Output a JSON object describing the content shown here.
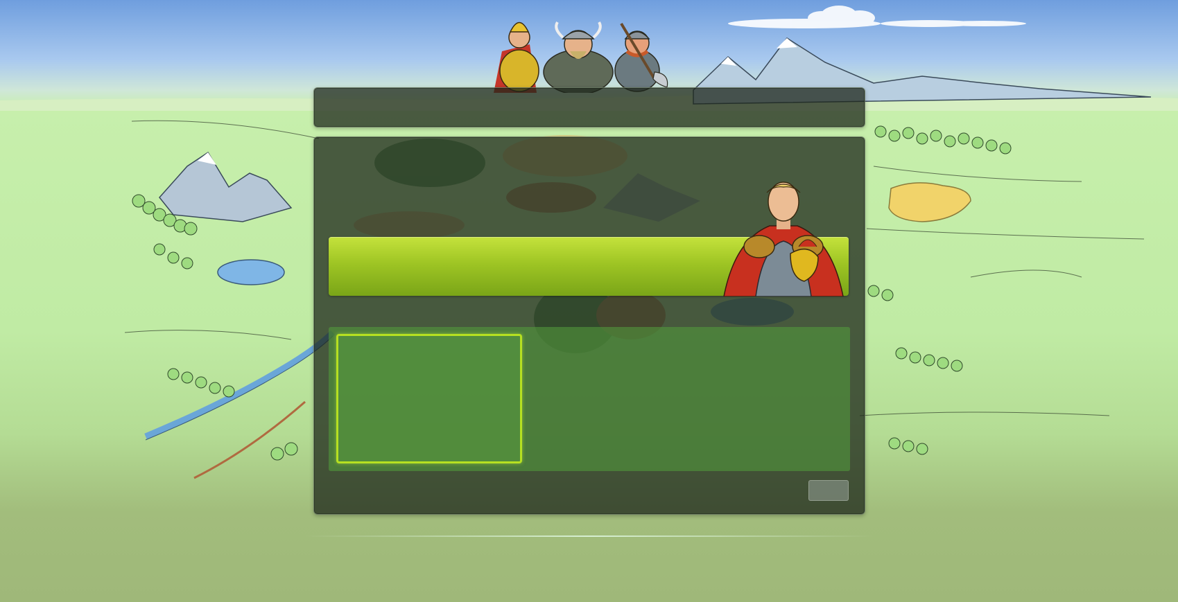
{
  "scene": {
    "name": "game-login-screen",
    "colors": {
      "sky": "#6f9ede",
      "meadow": "#c0eba4",
      "panel": "#1c261a",
      "banner": "#9ec524",
      "card_border": "#b6e021",
      "button": "#78846f"
    }
  },
  "title_panel": {
    "title": ""
  },
  "banner": {
    "label": ""
  },
  "world_card": {
    "label": ""
  },
  "action_button": {
    "label": ""
  },
  "illustrations": {
    "heroes_group": [
      "golden-armor-warrior",
      "horned-helmet-viking",
      "axe-viking"
    ],
    "hero_portrait": "caped-roman-hero-with-helmet"
  }
}
